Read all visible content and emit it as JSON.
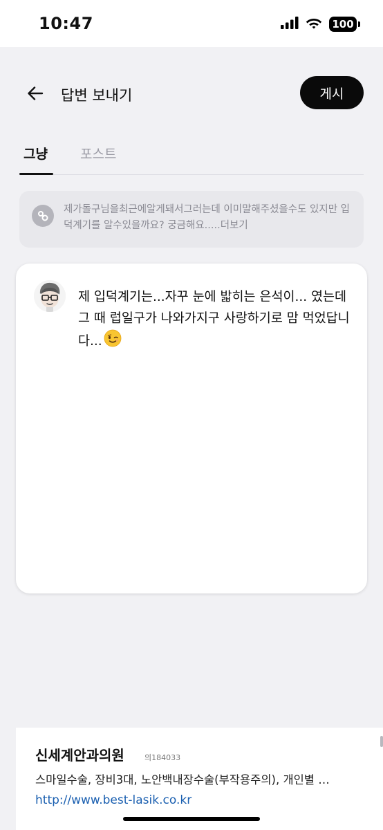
{
  "status": {
    "time": "10:47",
    "battery": "100"
  },
  "header": {
    "title": "답변 보내기",
    "post_label": "게시"
  },
  "tabs": [
    {
      "label": "그냥",
      "active": true
    },
    {
      "label": "포스트",
      "active": false
    }
  ],
  "quote": {
    "text": "제가돌구님을최근에알게돼서그러는데 이미말해주셨을수도 있지만 입덕계기를 알수있을까요? 궁금해요.....더보기"
  },
  "reply": {
    "text": "제 입덕계기는...자꾸 눈에 밟히는 은석이... 였는데 그 때 럽일구가 나와가지구 사랑하기로 맘 먹었답니다...",
    "emoji": "winking-face-emoji"
  },
  "ad": {
    "name": "신세계안과의원",
    "license": "의184033",
    "description": "스마일수술, 장비3대, 노안백내장수술(부작용주의), 개인별 …",
    "url": "http://www.best-lasik.co.kr"
  },
  "colors": {
    "accent": "#0a0a0a",
    "link": "#1a5fb0",
    "muted": "#9a9aa4"
  }
}
